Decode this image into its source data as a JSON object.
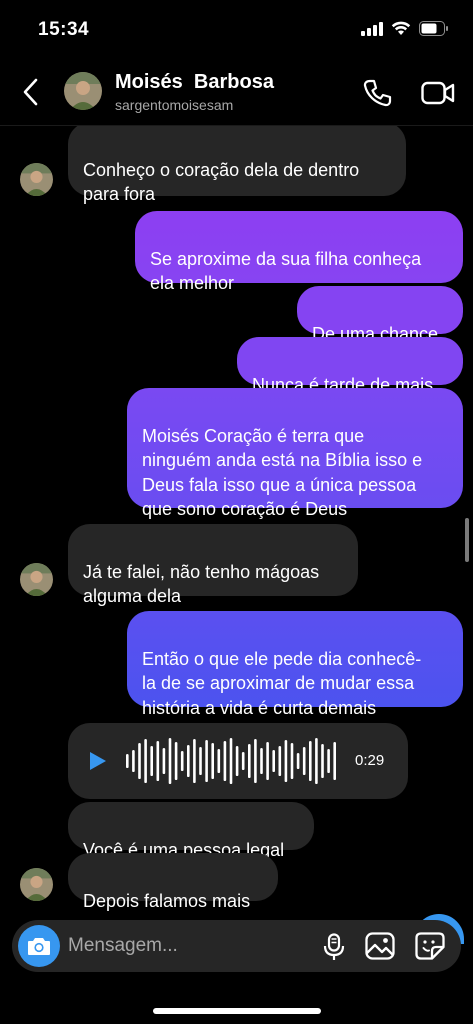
{
  "status_bar": {
    "time": "15:34",
    "icons": [
      "signal-icon",
      "wifi-icon",
      "battery-icon"
    ]
  },
  "header": {
    "contact_name": "Moisés  Barbosa",
    "username": "sargentomoisesam",
    "icons": [
      "back-arrow-icon",
      "phone-icon",
      "video-camera-icon"
    ]
  },
  "messages": [
    {
      "direction": "received",
      "text": "Conheço o coração dela de dentro\npara fora"
    },
    {
      "direction": "sent",
      "text": "Se aproxime da sua filha conheça\nela melhor"
    },
    {
      "direction": "sent",
      "text": "De uma chance"
    },
    {
      "direction": "sent",
      "text": "Nunca é tarde de mais"
    },
    {
      "direction": "sent",
      "text": "Moisés Coração é terra que\nninguém anda está na Bíblia isso e\nDeus fala isso que a única pessoa\nque sono coração é Deus"
    },
    {
      "direction": "received",
      "text": "Já te falei, não tenho mágoas\nalguma dela"
    },
    {
      "direction": "sent",
      "text": "Então o que ele pede dia conhecê-\nla de se aproximar de mudar essa\nhistória a vida é curta demais"
    },
    {
      "direction": "received",
      "type": "voice",
      "duration": "0:29"
    },
    {
      "direction": "received",
      "text": "Você é uma pessoa legal"
    },
    {
      "direction": "received",
      "text": "Depois falamos mais"
    }
  ],
  "composer": {
    "placeholder": "Mensagem...",
    "icons": [
      "camera-icon",
      "microphone-icon",
      "gallery-icon",
      "sticker-icon"
    ]
  },
  "colors": {
    "background": "#000000",
    "received_bubble": "#262626",
    "sent_gradient_top": "#8a3ff0",
    "sent_gradient_bottom": "#4f52f0",
    "accent": "#3797f0"
  }
}
